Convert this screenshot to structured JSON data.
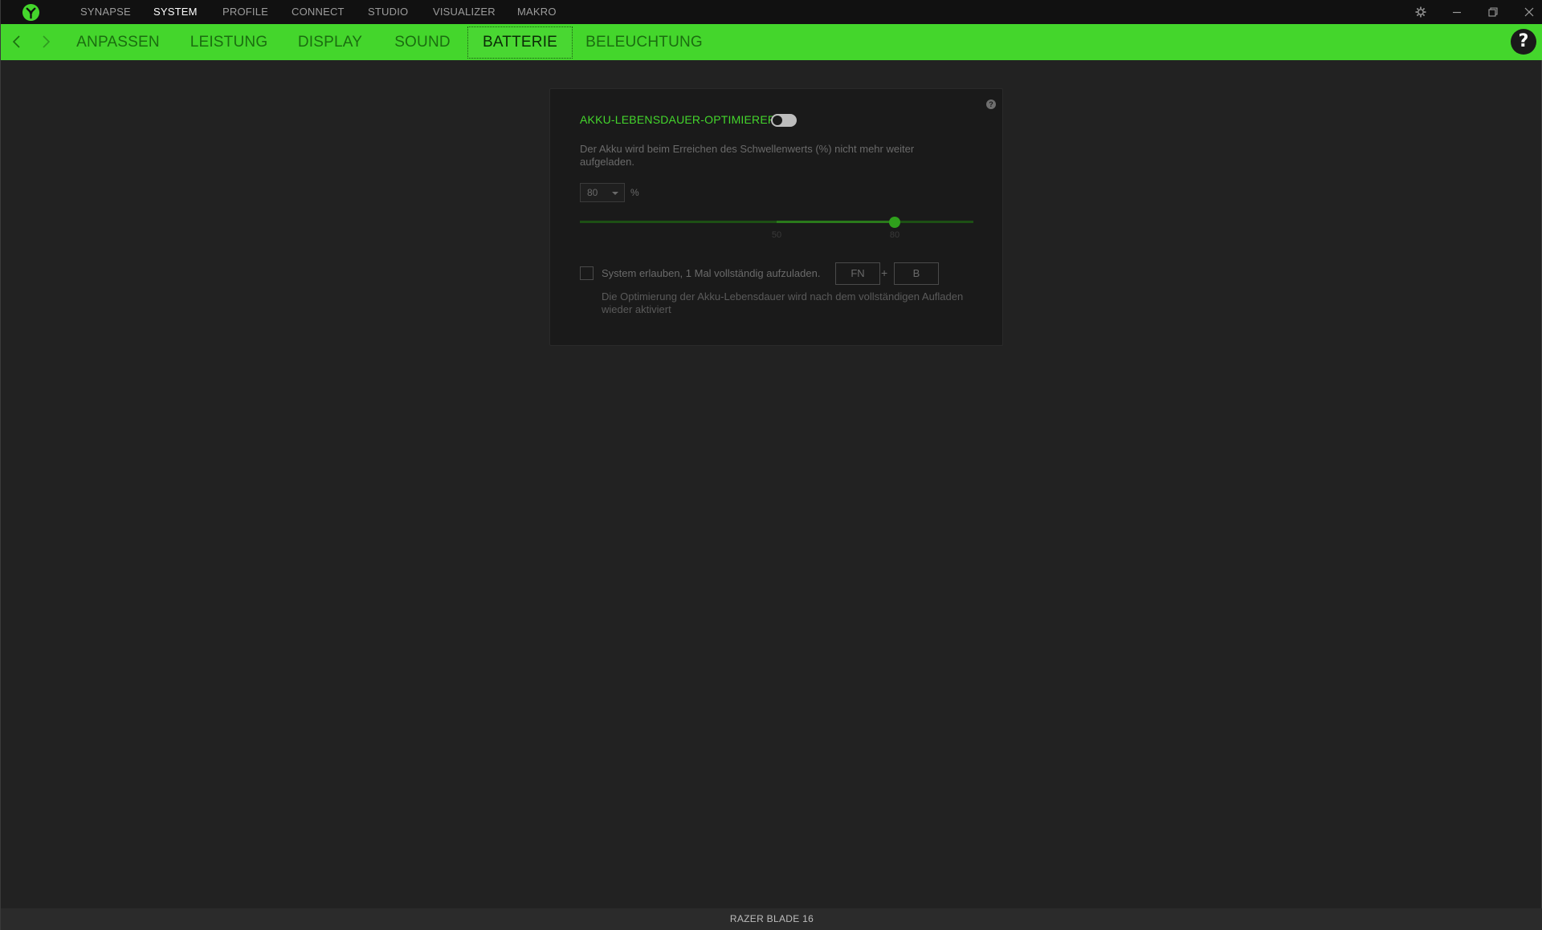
{
  "topnav": {
    "items": [
      {
        "label": "SYNAPSE",
        "active": false
      },
      {
        "label": "SYSTEM",
        "active": true
      },
      {
        "label": "PROFILE",
        "active": false
      },
      {
        "label": "CONNECT",
        "active": false
      },
      {
        "label": "STUDIO",
        "active": false
      },
      {
        "label": "VISUALIZER",
        "active": false
      },
      {
        "label": "MAKRO",
        "active": false
      }
    ],
    "icons": [
      "razer-logo-icon",
      "gear-icon",
      "minimize-icon",
      "restore-icon",
      "close-icon"
    ]
  },
  "subnav": {
    "tabs": [
      {
        "label": "ANPASSEN",
        "active": false
      },
      {
        "label": "LEISTUNG",
        "active": false
      },
      {
        "label": "DISPLAY",
        "active": false
      },
      {
        "label": "SOUND",
        "active": false
      },
      {
        "label": "BATTERIE",
        "active": true
      },
      {
        "label": "BELEUCHTUNG",
        "active": false
      }
    ],
    "help_symbol": "?"
  },
  "battery": {
    "title": "AKKU-LEBENSDAUER-OPTIMIERER",
    "toggle_on": false,
    "description": "Der Akku wird beim Erreichen des Schwellenwerts (%) nicht mehr weiter aufgeladen.",
    "threshold_value": "80",
    "threshold_unit": "%",
    "slider": {
      "min": 0,
      "max": 100,
      "range_start": 50,
      "value": 80,
      "tick_labels": [
        "50",
        "80"
      ]
    },
    "full_charge_checkbox_checked": false,
    "full_charge_label": "System erlauben, 1 Mal vollständig aufzuladen.",
    "shortcut_key1": "FN",
    "shortcut_plus": "+",
    "shortcut_key2": "B",
    "full_charge_note": "Die Optimierung der Akku-Lebensdauer wird nach dem vollständigen Aufladen wieder aktiviert",
    "help_symbol": "?"
  },
  "footer": {
    "device_name": "RAZER BLADE 16"
  },
  "colors": {
    "accent": "#44d62c",
    "background": "#222222",
    "topbar": "#111111",
    "card": "#1a1a1a"
  }
}
